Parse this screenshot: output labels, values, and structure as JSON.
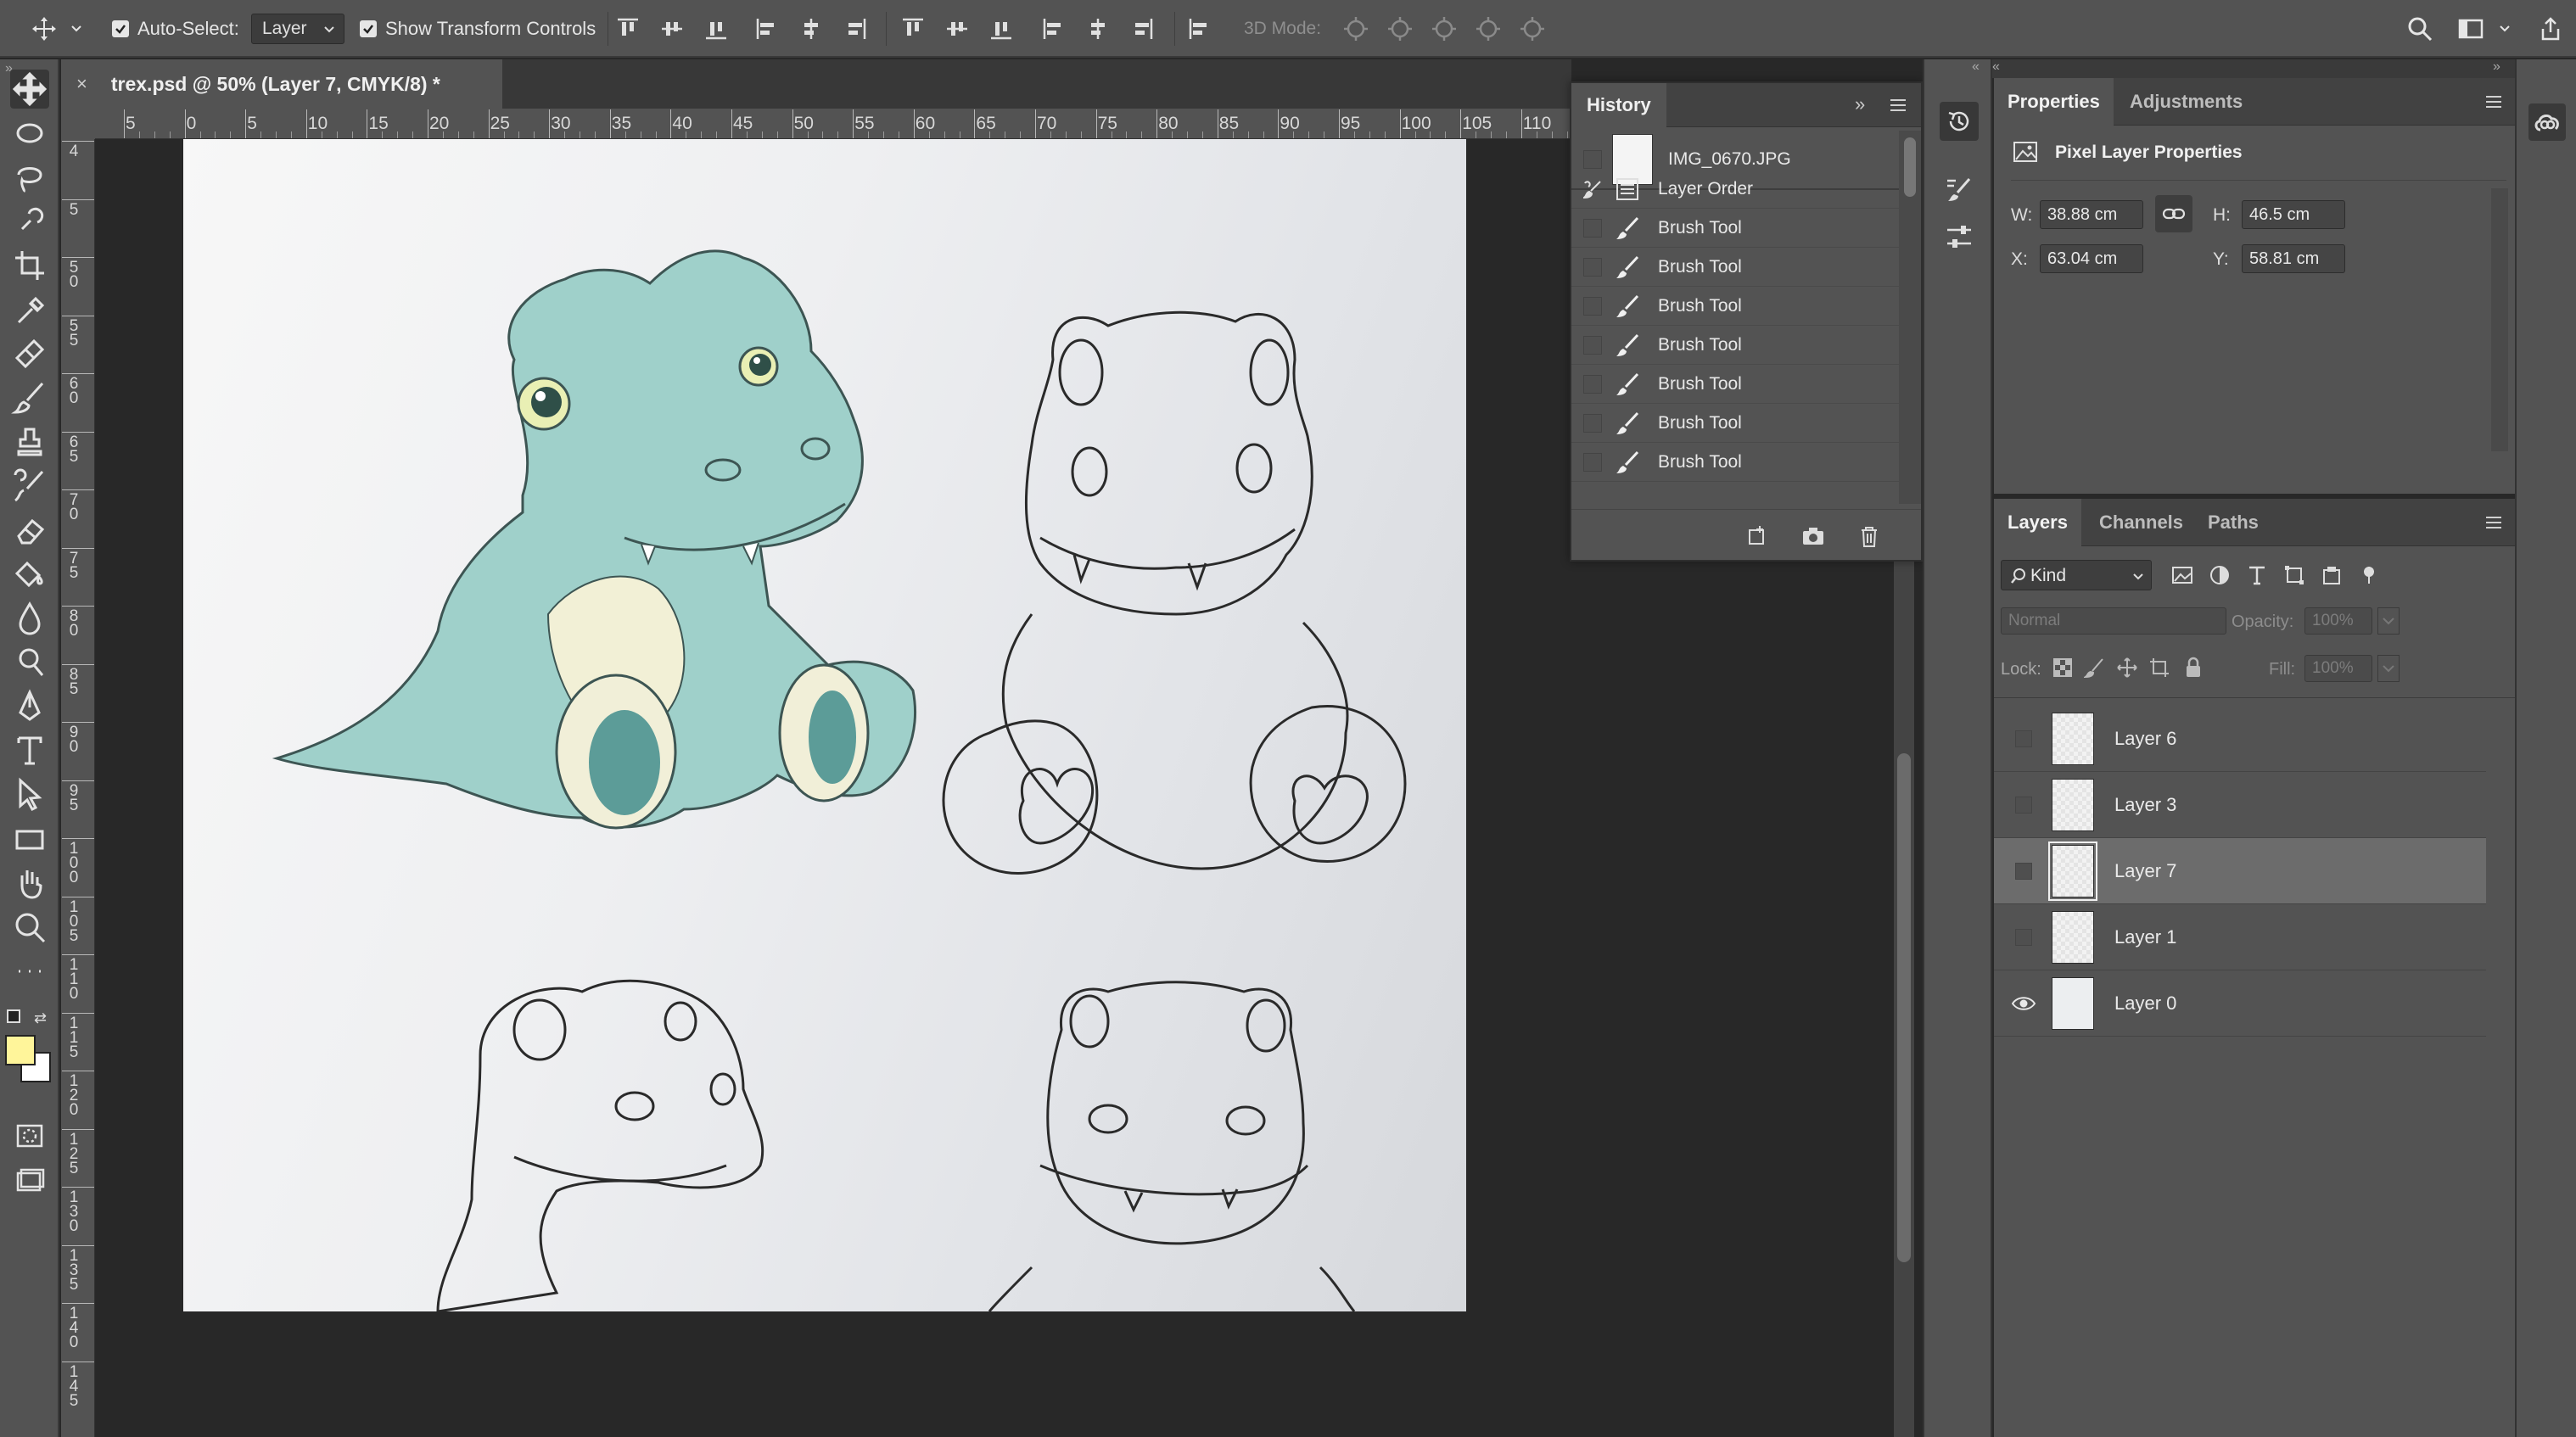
{
  "options_bar": {
    "auto_select_label": "Auto-Select:",
    "auto_select_value": "Layer",
    "transform_controls_label": "Show Transform Controls",
    "mode_3d_label": "3D Mode:"
  },
  "document": {
    "tab_title": "trex.psd @ 50% (Layer 7, CMYK/8) *",
    "close_glyph": "×",
    "ruler_h": [
      "5",
      "0",
      "5",
      "10",
      "15",
      "20",
      "25",
      "30",
      "35",
      "40",
      "45",
      "50",
      "55",
      "60",
      "65",
      "70",
      "75",
      "80",
      "85",
      "90",
      "95",
      "100",
      "105",
      "110"
    ],
    "ruler_v": [
      "4",
      "5",
      "5 0",
      "5 5",
      "6 0",
      "6 5",
      "7 0",
      "7 5",
      "8 0",
      "8 5",
      "9 0",
      "9 5",
      "1 0 0",
      "1 0 5",
      "1 1 0",
      "1 1 5",
      "1 2 0",
      "1 2 5",
      "1 3 0",
      "1 3 5",
      "1 4 0",
      "1 4 5"
    ]
  },
  "history": {
    "title": "History",
    "items": [
      {
        "label": "IMG_0670.JPG",
        "icon": "snapshot-thumbnail"
      },
      {
        "label": "Layer Order",
        "icon": "layer-order-icon"
      },
      {
        "label": "Brush Tool",
        "icon": "brush-icon"
      },
      {
        "label": "Brush Tool",
        "icon": "brush-icon"
      },
      {
        "label": "Brush Tool",
        "icon": "brush-icon"
      },
      {
        "label": "Brush Tool",
        "icon": "brush-icon"
      },
      {
        "label": "Brush Tool",
        "icon": "brush-icon"
      },
      {
        "label": "Brush Tool",
        "icon": "brush-icon"
      },
      {
        "label": "Brush Tool",
        "icon": "brush-icon"
      }
    ]
  },
  "properties": {
    "tabs": [
      "Properties",
      "Adjustments"
    ],
    "section_title": "Pixel Layer Properties",
    "w_label": "W:",
    "w_value": "38.88 cm",
    "h_label": "H:",
    "h_value": "46.5 cm",
    "x_label": "X:",
    "x_value": "63.04 cm",
    "y_label": "Y:",
    "y_value": "58.81 cm"
  },
  "layers": {
    "tabs": [
      "Layers",
      "Channels",
      "Paths"
    ],
    "filter_kind": "Kind",
    "blend_mode": "Normal",
    "opacity_label": "Opacity:",
    "opacity_value": "100%",
    "lock_label": "Lock:",
    "fill_label": "Fill:",
    "fill_value": "100%",
    "items": [
      {
        "name": "Layer 6",
        "visible": false,
        "selected": false
      },
      {
        "name": "Layer 3",
        "visible": false,
        "selected": false
      },
      {
        "name": "Layer 7",
        "visible": false,
        "selected": true
      },
      {
        "name": "Layer 1",
        "visible": false,
        "selected": false
      },
      {
        "name": "Layer 0",
        "visible": true,
        "selected": false
      }
    ]
  },
  "colors": {
    "foreground": "#fff59a",
    "background": "#ffffff",
    "dino_fill": "#8ec9c3"
  }
}
